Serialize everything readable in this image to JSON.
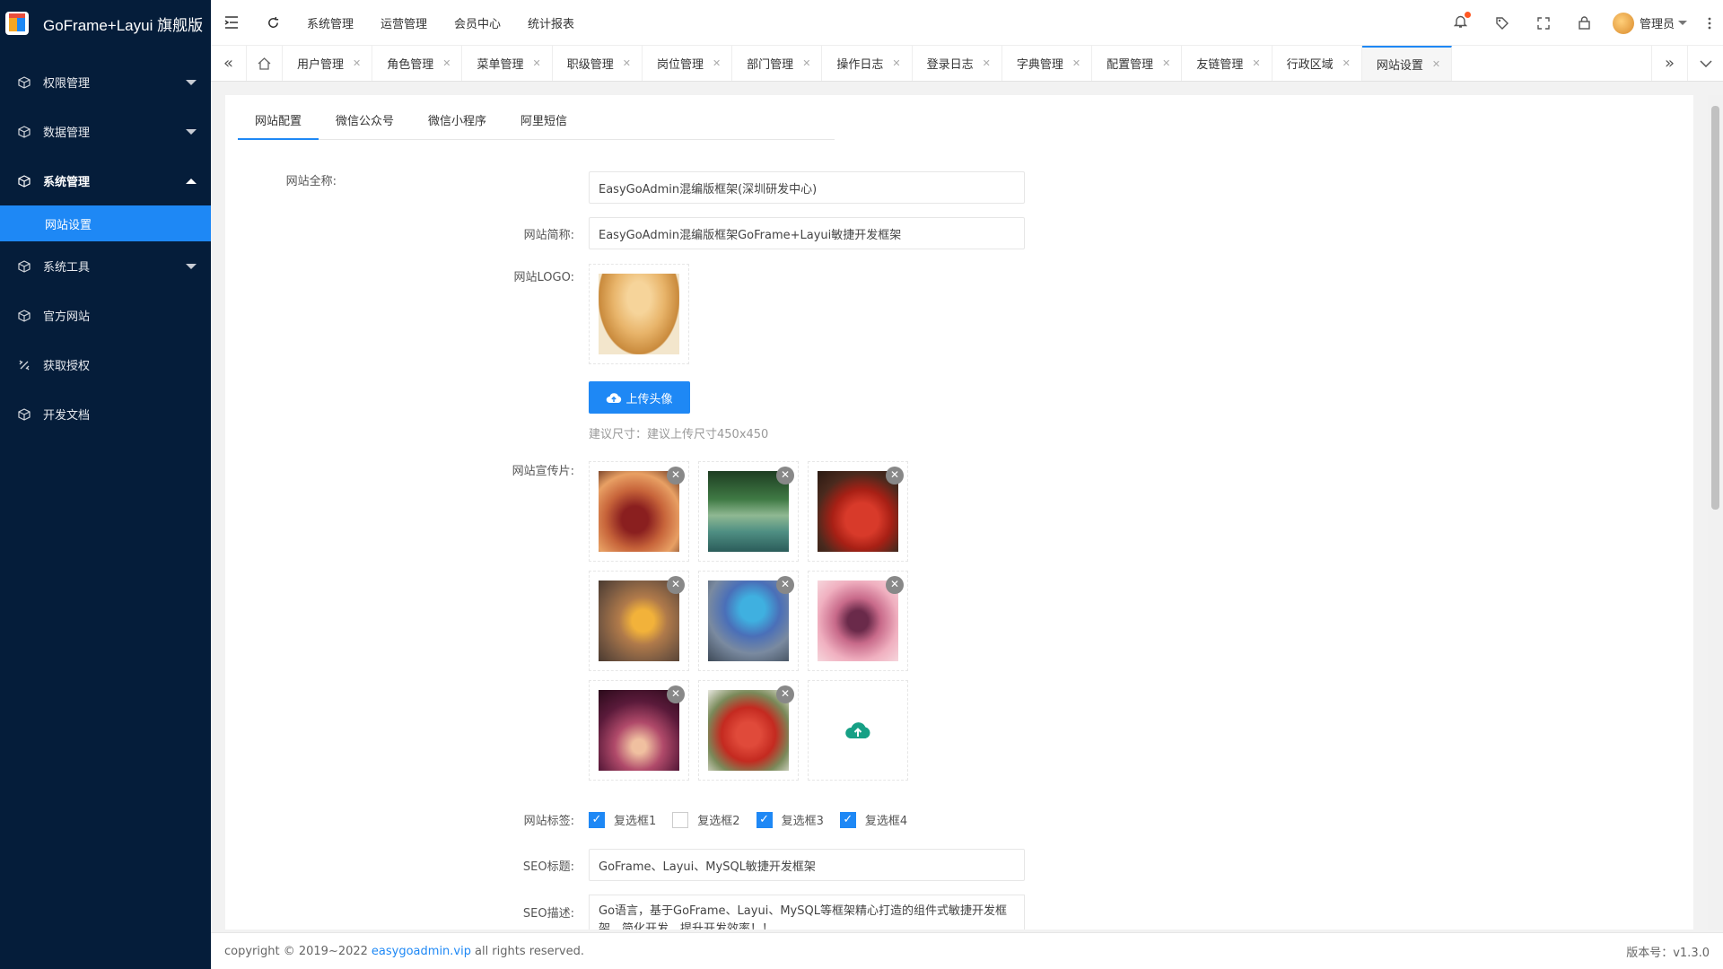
{
  "app": {
    "title": "GoFrame+Layui 旗舰版"
  },
  "sidebar": {
    "items": [
      {
        "label": "权限管理",
        "icon": "cube-icon"
      },
      {
        "label": "数据管理",
        "icon": "cube-icon"
      },
      {
        "label": "系统管理",
        "icon": "cube-icon"
      },
      {
        "label": "系统工具",
        "icon": "cube-icon"
      },
      {
        "label": "官方网站",
        "icon": "cube-icon"
      },
      {
        "label": "获取授权",
        "icon": "link-icon"
      },
      {
        "label": "开发文档",
        "icon": "cube-icon"
      }
    ],
    "active_sub": "网站设置"
  },
  "topbar": {
    "nav": [
      "系统管理",
      "运营管理",
      "会员中心",
      "统计报表"
    ],
    "user": "管理员"
  },
  "tabs": [
    "用户管理",
    "角色管理",
    "菜单管理",
    "职级管理",
    "岗位管理",
    "部门管理",
    "操作日志",
    "登录日志",
    "字典管理",
    "配置管理",
    "友链管理",
    "行政区域",
    "网站设置"
  ],
  "subtabs": [
    "网站配置",
    "微信公众号",
    "微信小程序",
    "阿里短信"
  ],
  "form": {
    "site_name_label": "网站全称:",
    "site_name": "EasyGoAdmin混编版框架(深圳研发中心)",
    "site_short_label": "网站简称:",
    "site_short": "EasyGoAdmin混编版框架GoFrame+Layui敏捷开发框架",
    "logo_label": "网站LOGO:",
    "upload_btn": "上传头像",
    "upload_hint": "建议尺寸：建议上传尺寸450x450",
    "promo_label": "网站宣传片:",
    "tags_label": "网站标签:",
    "checkboxes": [
      {
        "label": "复选框1",
        "checked": true
      },
      {
        "label": "复选框2",
        "checked": false
      },
      {
        "label": "复选框3",
        "checked": true
      },
      {
        "label": "复选框4",
        "checked": true
      }
    ],
    "seo_title_label": "SEO标题:",
    "seo_title": "GoFrame、Layui、MySQL敏捷开发框架",
    "seo_desc_label": "SEO描述:",
    "seo_desc": "Go语言，基于GoFrame、Layui、MySQL等框架精心打造的组件式敏捷开发框架，简化开发，提升开发效率！！"
  },
  "footer": {
    "copyright": "copyright © 2019~2022",
    "link": "easygoadmin.vip",
    "rights": "all rights reserved.",
    "version": "版本号：v1.3.0"
  },
  "colors": {
    "accent": "#1e88f5",
    "sidebar": "#051d3a"
  }
}
